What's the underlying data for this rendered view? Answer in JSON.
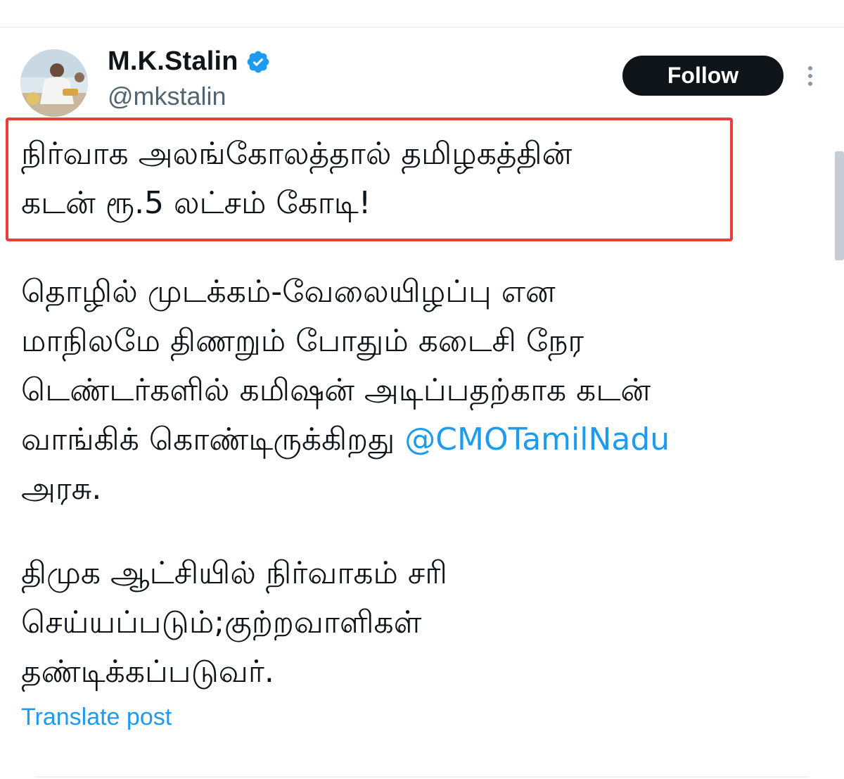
{
  "author": {
    "display_name": "M.K.Stalin",
    "handle": "@mkstalin",
    "verified": true
  },
  "actions": {
    "follow_label": "Follow",
    "more_icon": "more-vertical-icon"
  },
  "tweet": {
    "headline": [
      "நிர்வாக அலங்கோலத்தால் தமிழகத்தின்",
      "கடன் ரூ.5 லட்சம் கோடி!"
    ],
    "paragraph1": [
      "தொழில் முடக்கம்-வேலையிழப்பு என",
      "மாநிலமே திணறும் போதும் கடைசி நேர",
      "டெண்டர்களில் கமிஷன் அடிப்பதற்காக கடன்",
      "வாங்கிக் கொண்டிருக்கிறது ",
      "அரசு."
    ],
    "mention": "@CMOTamilNadu",
    "paragraph2": [
      "திமுக ஆட்சியில் நிர்வாகம் சரி",
      "செய்யப்படும்;குற்றவாளிகள்",
      "தண்டிக்கப்படுவர்."
    ],
    "translate_label": "Translate post"
  },
  "colors": {
    "accent": "#1d9bf0",
    "highlight_border": "#ef3b3a",
    "text": "#0f1419",
    "secondary_text": "#536471"
  }
}
